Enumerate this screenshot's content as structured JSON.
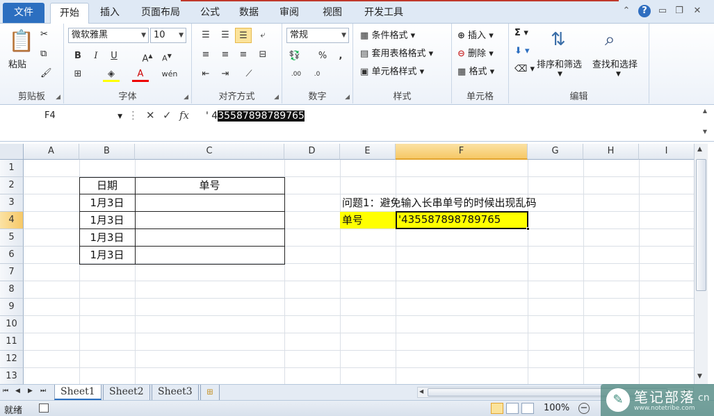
{
  "tabs": [
    "文件",
    "开始",
    "插入",
    "页面布局",
    "公式",
    "数据",
    "审阅",
    "视图",
    "开发工具"
  ],
  "active_tab": "开始",
  "ribbon": {
    "clipboard": {
      "paste": "粘贴",
      "label": "剪贴板"
    },
    "font": {
      "name": "微软雅黑",
      "size": "10",
      "bold": "B",
      "italic": "I",
      "underline": "U",
      "label": "字体"
    },
    "alignment": {
      "label": "对齐方式"
    },
    "number": {
      "format": "常规",
      "percent": "%",
      "comma": ",",
      "label": "数字"
    },
    "styles": {
      "conditional": "条件格式",
      "table": "套用表格格式",
      "cell": "单元格样式",
      "label": "样式"
    },
    "cells": {
      "insert": "插入",
      "delete": "删除",
      "format": "格式",
      "label": "单元格"
    },
    "editing": {
      "sum": "Σ",
      "sort": "排序和筛选",
      "find": "查找和选择",
      "label": "编辑"
    }
  },
  "formula_bar": {
    "name_box": "F4",
    "cancel": "✕",
    "enter": "✓",
    "fx": "fx",
    "prefix": "' 4",
    "selected": "35587898789765"
  },
  "columns": [
    "A",
    "B",
    "C",
    "D",
    "E",
    "F",
    "G",
    "H",
    "I"
  ],
  "selected_column": "F",
  "rows": [
    "1",
    "2",
    "3",
    "4",
    "5",
    "6",
    "7",
    "8",
    "9",
    "10",
    "11",
    "12",
    "13"
  ],
  "selected_row": "4",
  "cells": {
    "b2": "日期",
    "c2": "单号",
    "b3": "1月3日",
    "b4": "1月3日",
    "b5": "1月3日",
    "b6": "1月3日",
    "e3": "问题1：避免输入长串单号的时候出现乱码",
    "e4": "单号",
    "f4": "'435587898789765"
  },
  "highlight_color": "#ffff00",
  "sheets": [
    "Sheet1",
    "Sheet2",
    "Sheet3"
  ],
  "active_sheet": "Sheet1",
  "status": {
    "ready": "就绪",
    "zoom": "100%"
  },
  "watermark": {
    "title": "笔记部落",
    "url": "www.notetribe.com",
    "suffix": "cn"
  }
}
